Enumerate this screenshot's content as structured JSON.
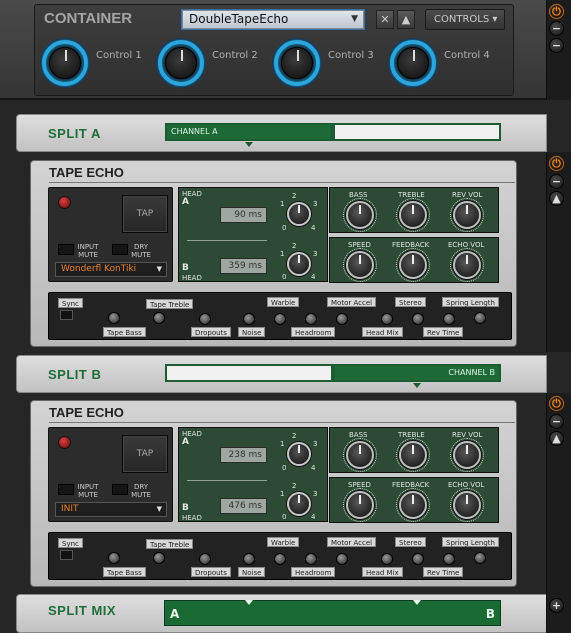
{
  "container": {
    "title": "CONTAINER",
    "preset": "DoubleTapeEcho",
    "controls_label": "CONTROLS",
    "close_glyph": "✕",
    "up_glyph": "▲",
    "knobs": [
      "Control 1",
      "Control 2",
      "Control 3",
      "Control 4"
    ]
  },
  "split_a": {
    "title": "SPLIT A",
    "channel": "CHANNEL A"
  },
  "split_b": {
    "title": "SPLIT B",
    "channel": "CHANNEL B"
  },
  "split_mix": {
    "title": "SPLIT MIX",
    "left": "A",
    "right": "B"
  },
  "side_glyphs": {
    "power": "⏻",
    "minus": "−",
    "up": "▲",
    "plus": "+"
  },
  "modules": [
    {
      "title": "TAPE ECHO",
      "tap": "TAP",
      "input_mute": "INPUT MUTE",
      "dry_mute": "DRY MUTE",
      "preset": "Wonderfl KonTiki",
      "head_a": {
        "head": "HEAD",
        "letter": "A",
        "ms": "90 ms"
      },
      "head_b": {
        "head": "HEAD",
        "letter": "B",
        "ms": "359 ms"
      },
      "knob_nums": [
        "1",
        "2",
        "3",
        "0",
        "4"
      ],
      "right_top": [
        "BASS",
        "TREBLE",
        "REV VOL"
      ],
      "right_bottom": [
        "SPEED",
        "FEEDBACK",
        "ECHO VOL"
      ],
      "strip": {
        "sync": "Sync",
        "tape_treble": "Tape Treble",
        "warble": "Warble",
        "motor_accel": "Motor Accel",
        "stereo": "Stereo",
        "spring_length": "Spring Length",
        "tape_bass": "Tape Bass",
        "dropouts": "Dropouts",
        "noise": "Noise",
        "headroom": "Headroom",
        "head_mix": "Head Mix",
        "rev_time": "Rev Time"
      }
    },
    {
      "title": "TAPE ECHO",
      "tap": "TAP",
      "input_mute": "INPUT MUTE",
      "dry_mute": "DRY MUTE",
      "preset": "INIT",
      "head_a": {
        "head": "HEAD",
        "letter": "A",
        "ms": "238 ms"
      },
      "head_b": {
        "head": "HEAD",
        "letter": "B",
        "ms": "476 ms"
      },
      "knob_nums": [
        "1",
        "2",
        "3",
        "0",
        "4"
      ],
      "right_top": [
        "BASS",
        "TREBLE",
        "REV VOL"
      ],
      "right_bottom": [
        "SPEED",
        "FEEDBACK",
        "ECHO VOL"
      ],
      "strip": {
        "sync": "Sync",
        "tape_treble": "Tape Treble",
        "warble": "Warble",
        "motor_accel": "Motor Accel",
        "stereo": "Stereo",
        "spring_length": "Spring Length",
        "tape_bass": "Tape Bass",
        "dropouts": "Dropouts",
        "noise": "Noise",
        "headroom": "Headroom",
        "head_mix": "Head Mix",
        "rev_time": "Rev Time"
      }
    }
  ],
  "colors": {
    "accent_green": "#1d6a37",
    "knob_ring": "#2ba6dc",
    "power": "#f08a1c",
    "preset_text": "#e8832e"
  }
}
